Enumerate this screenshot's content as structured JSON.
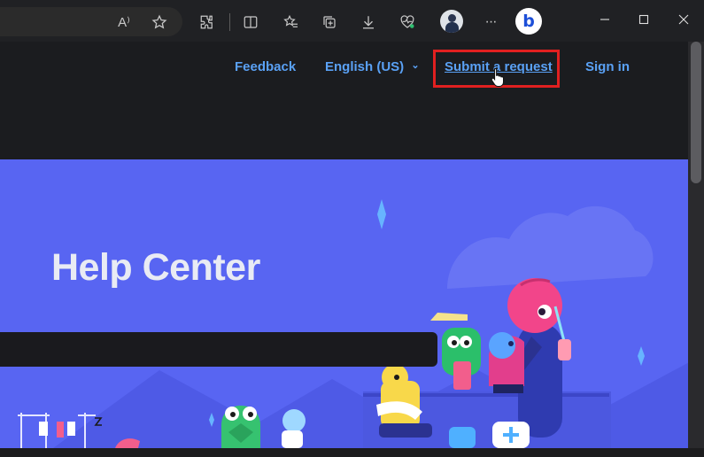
{
  "browser": {
    "icons": [
      "read-aloud-icon",
      "favorite-star-icon",
      "extensions-icon",
      "split-screen-icon",
      "favorites-list-icon",
      "collections-icon",
      "downloads-icon",
      "browser-essentials-icon",
      "profile-avatar",
      "more-icon",
      "bing-copilot-icon"
    ],
    "read_aloud_glyph": "A⁾",
    "more_glyph": "···",
    "bing_glyph": "b"
  },
  "nav": {
    "feedback": "Feedback",
    "language": "English (US)",
    "language_chevron": "⌄",
    "submit": "Submit a request",
    "signin": "Sign in"
  },
  "hero": {
    "title": "Help Center"
  },
  "colors": {
    "accent_link": "#5aa1f5",
    "hero_bg": "#5865f2",
    "highlight_box": "#e12020"
  }
}
